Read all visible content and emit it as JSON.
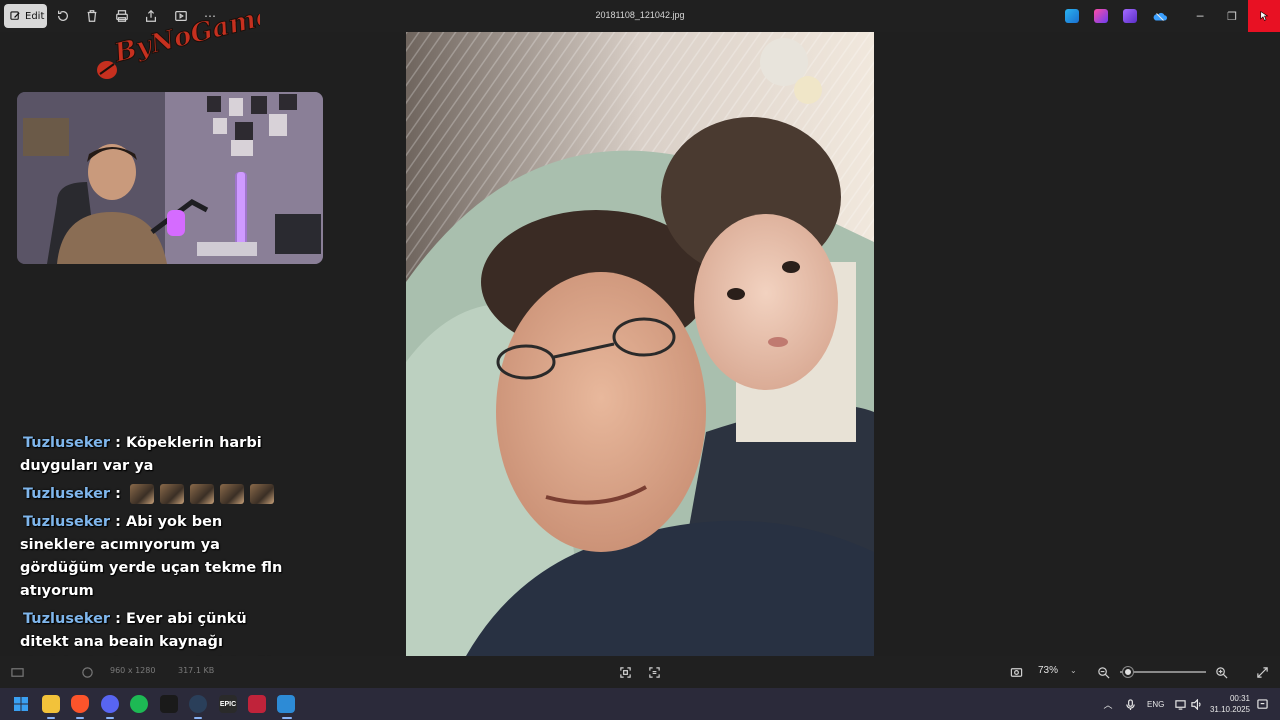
{
  "toolbar": {
    "edit_label": "Edit",
    "file_title": "20181108_121042.jpg"
  },
  "overlay": {
    "logo_text": "ByNoGame",
    "chat": [
      {
        "user": "Tuzluseker",
        "text": ": Köpeklerin harbi duyguları var ya",
        "emotes": 0
      },
      {
        "user": "Tuzluseker",
        "text": ":",
        "emotes": 5
      },
      {
        "user": "Tuzluseker",
        "text": ": Abi yok ben sineklere acımıyorum ya gördüğüm yerde uçan tekme fln atıyorum",
        "emotes": 0
      },
      {
        "user": "Tuzluseker",
        "text": ": Ever abi çünkü ditekt ana beain kaynağı sivrisinek olan veya sivrisineğin ana besin kaynağı diye bi şey yok o yüzden ekosisteme faydası yok",
        "emotes": 0
      }
    ]
  },
  "statusbar": {
    "dimensions": "960 x 1280",
    "filesize": "317.1 KB",
    "zoom_label": "73%",
    "zoom_level_percent": 73
  },
  "taskbar": {
    "lang": "ENG",
    "time": "00:31",
    "date": "31.10.2025",
    "apps": [
      {
        "name": "start",
        "color": "#3aa0f2"
      },
      {
        "name": "file-explorer",
        "color": "#f2c23a"
      },
      {
        "name": "brave",
        "color": "#fb542b"
      },
      {
        "name": "discord",
        "color": "#5865f2"
      },
      {
        "name": "spotify",
        "color": "#1db954"
      },
      {
        "name": "app-dark",
        "color": "#1a1a1a"
      },
      {
        "name": "steam",
        "color": "#2a3f5a"
      },
      {
        "name": "epic-games",
        "color": "#2a2a2a"
      },
      {
        "name": "valorant",
        "color": "#c0233a"
      },
      {
        "name": "photos",
        "color": "#2d8bd6"
      }
    ]
  },
  "colors": {
    "chat_user": "#7fb6ec",
    "close_button": "#e81123",
    "taskbar_bg": "#2b2a3a"
  }
}
